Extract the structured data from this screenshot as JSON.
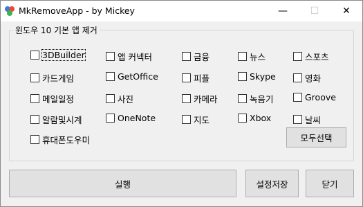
{
  "window": {
    "title": "MkRemoveApp - by Mickey",
    "controls": {
      "minimize": "—",
      "maximize": "☐",
      "close": "✕"
    }
  },
  "group": {
    "legend": "윈도우 10 기본 앱 제거"
  },
  "apps": [
    {
      "label": "3DBuilder",
      "checked": false
    },
    {
      "label": "앱 커넥터",
      "checked": false
    },
    {
      "label": "금융",
      "checked": false
    },
    {
      "label": "뉴스",
      "checked": false
    },
    {
      "label": "스포츠",
      "checked": false
    },
    {
      "label": "카드게임",
      "checked": false
    },
    {
      "label": "GetOffice",
      "checked": false
    },
    {
      "label": "피플",
      "checked": false
    },
    {
      "label": "Skype",
      "checked": false
    },
    {
      "label": "영화",
      "checked": false
    },
    {
      "label": "메일일정",
      "checked": false
    },
    {
      "label": "사진",
      "checked": false
    },
    {
      "label": "카메라",
      "checked": false
    },
    {
      "label": "녹음기",
      "checked": false
    },
    {
      "label": "Groove",
      "checked": false
    },
    {
      "label": "알람및시계",
      "checked": false
    },
    {
      "label": "OneNote",
      "checked": false
    },
    {
      "label": "지도",
      "checked": false
    },
    {
      "label": "Xbox",
      "checked": false
    },
    {
      "label": "날씨",
      "checked": false
    },
    {
      "label": "휴대폰도우미",
      "checked": false
    }
  ],
  "buttons": {
    "select_all": "모두선택",
    "run": "실행",
    "save_settings": "설정저장",
    "close": "닫기"
  }
}
